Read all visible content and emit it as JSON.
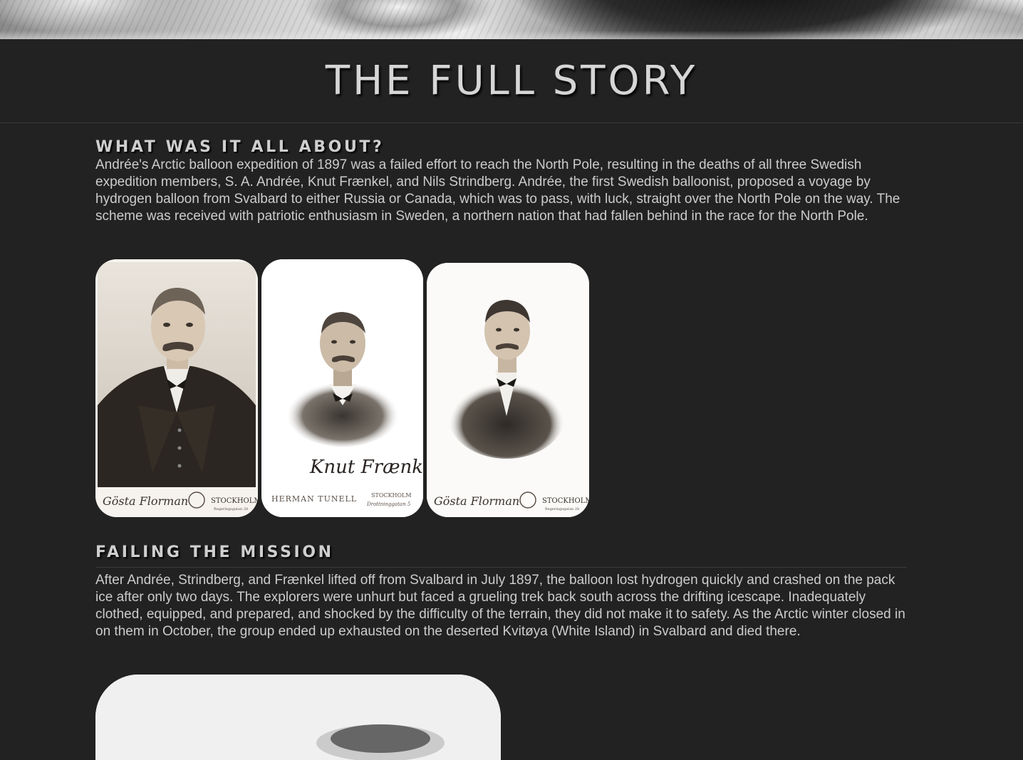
{
  "page": {
    "title": "THE FULL STORY"
  },
  "sections": [
    {
      "heading": "WHAT WAS IT ALL ABOUT?",
      "body": "Andrée's Arctic balloon expedition of 1897 was a failed effort to reach the North Pole, resulting in the deaths of all three Swedish expedition members, S. A. Andrée, Knut Frænkel, and Nils Strindberg. Andrée, the first Swedish balloonist, proposed a voyage by hydrogen balloon from Svalbard to either Russia or Canada, which was to pass, with luck, straight over the North Pole on the way. The scheme was received with patriotic enthusiasm in Sweden, a northern nation that had fallen behind in the race for the North Pole."
    },
    {
      "heading": "FAILING THE MISSION",
      "body": "After Andrée, Strindberg, and Frænkel lifted off from Svalbard in July 1897, the balloon lost hydrogen quickly and crashed on the pack ice after only two days. The explorers were unhurt but faced a grueling trek back south across the drifting icescape. Inadequately clothed, equipped, and prepared, and shocked by the difficulty of the terrain, they did not make it to safety. As the Arctic winter closed in on them in October, the group ended up exhausted on the deserted Kvitøya (White Island) in Svalbard and died there."
    }
  ],
  "portraits": [
    {
      "studio_signature": "Gösta Florman",
      "studio_city": "STOCKHOLM",
      "studio_address": "Regeringsgatan 28"
    },
    {
      "handwritten_signature": "Knut Frænkel",
      "studio_signature": "HERMAN TUNELL",
      "studio_city": "STOCKHOLM",
      "studio_address": "Drottninggatan 5"
    },
    {
      "studio_signature": "Gösta Florman",
      "studio_city": "STOCKHOLM",
      "studio_address": "Regeringsgatan 28"
    }
  ],
  "colors": {
    "background": "#222222",
    "text": "#cccccc",
    "heading": "#cfcfcf"
  }
}
